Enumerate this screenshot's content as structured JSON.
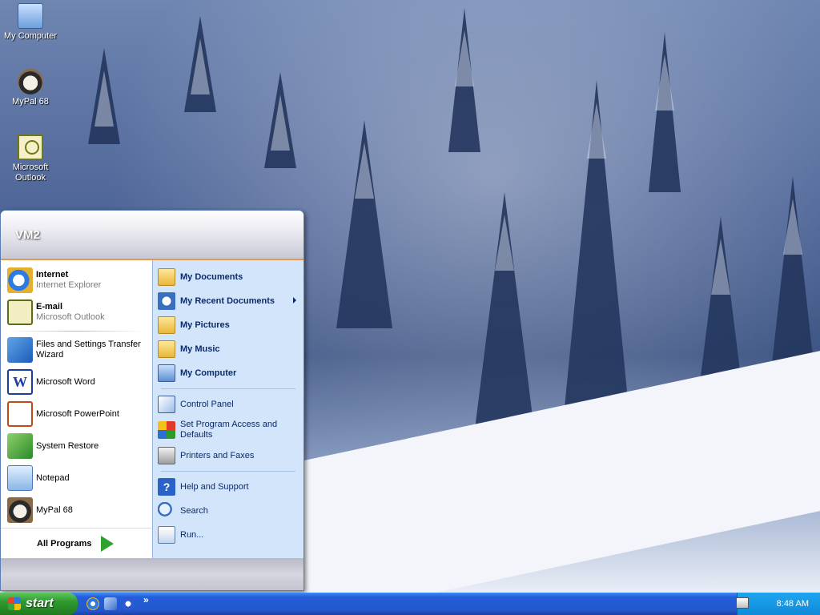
{
  "desktop": {
    "icons": [
      {
        "label": "My Computer"
      },
      {
        "label": "MyPal 68"
      },
      {
        "label": "Microsoft Outlook"
      }
    ]
  },
  "start_menu": {
    "user": "VM2",
    "pinned": [
      {
        "title": "Internet",
        "subtitle": "Internet Explorer",
        "icon": "ie-icon"
      },
      {
        "title": "E-mail",
        "subtitle": "Microsoft Outlook",
        "icon": "outlook-icon"
      }
    ],
    "recent": [
      {
        "title": "Files and Settings Transfer Wizard",
        "icon": "transfer-wizard-icon"
      },
      {
        "title": "Microsoft Word",
        "icon": "word-icon"
      },
      {
        "title": "Microsoft PowerPoint",
        "icon": "powerpoint-icon"
      },
      {
        "title": "System Restore",
        "icon": "system-restore-icon"
      },
      {
        "title": "Notepad",
        "icon": "notepad-icon"
      },
      {
        "title": "MyPal 68",
        "icon": "mypal-icon"
      }
    ],
    "all_programs": "All Programs",
    "places": [
      {
        "label": "My Documents",
        "icon": "documents-folder-icon"
      },
      {
        "label": "My Recent Documents",
        "icon": "recent-documents-icon"
      },
      {
        "label": "My Pictures",
        "icon": "pictures-folder-icon"
      },
      {
        "label": "My Music",
        "icon": "music-folder-icon"
      },
      {
        "label": "My Computer",
        "icon": "computer-icon"
      }
    ],
    "settings": [
      {
        "label": "Control Panel",
        "icon": "control-panel-icon"
      },
      {
        "label": "Set Program Access and Defaults",
        "icon": "program-access-icon"
      },
      {
        "label": "Printers and Faxes",
        "icon": "printer-icon"
      }
    ],
    "tools": [
      {
        "label": "Help and Support",
        "icon": "help-icon"
      },
      {
        "label": "Search",
        "icon": "search-icon"
      },
      {
        "label": "Run...",
        "icon": "run-icon"
      }
    ]
  },
  "taskbar": {
    "start_label": "start",
    "overflow": "»",
    "clock": "8:48 AM"
  }
}
